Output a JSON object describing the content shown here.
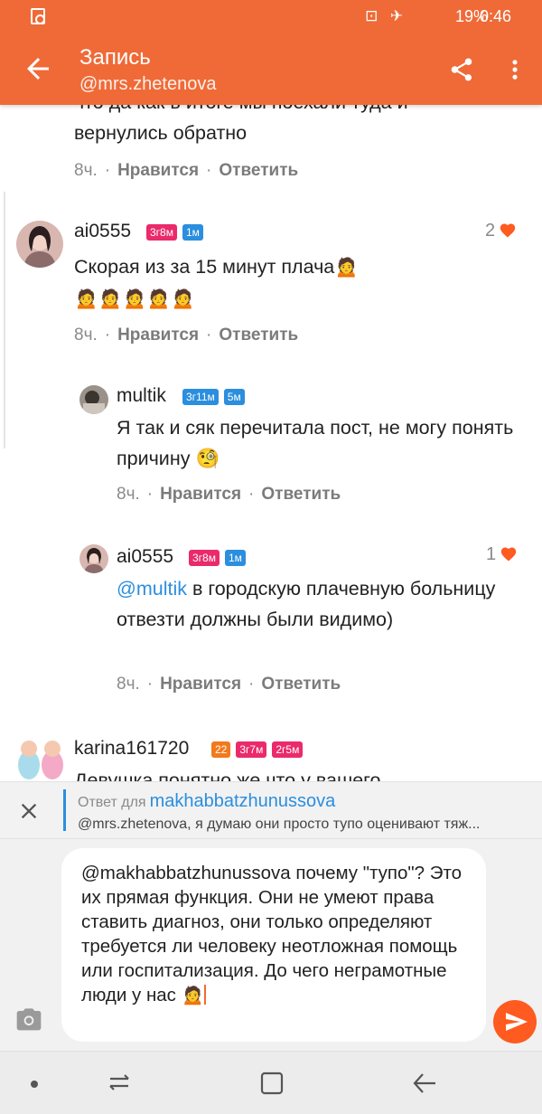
{
  "status_bar": {
    "icons": "⊡ ✈",
    "battery": "19%",
    "time": "0:46"
  },
  "app_bar": {
    "title": "Запись",
    "subtitle": "@mrs.zhetenova"
  },
  "comments": [
    {
      "text": "что да как в итоге мы поехали туда и вернулись обратно",
      "time": "8ч.",
      "like_label": "Нравится",
      "reply_label": "Ответить"
    },
    {
      "username": "ai0555",
      "badges": [
        {
          "label": "3г8м",
          "color": "pink"
        },
        {
          "label": "1м",
          "color": "blue"
        }
      ],
      "text": "Скорая из за 15 минут плача",
      "emoji_line": "🙍🙍🙍🙍🙍",
      "likes": "2",
      "time": "8ч.",
      "like_label": "Нравится",
      "reply_label": "Ответить"
    },
    {
      "username": "multik",
      "badges": [
        {
          "label": "3г11м",
          "color": "blue"
        },
        {
          "label": "5м",
          "color": "blue"
        }
      ],
      "text": "Я так и сяк перечитала пост, не могу понять причину",
      "time": "8ч.",
      "like_label": "Нравится",
      "reply_label": "Ответить"
    },
    {
      "username": "ai0555",
      "badges": [
        {
          "label": "3г8м",
          "color": "pink"
        },
        {
          "label": "1м",
          "color": "blue"
        }
      ],
      "mention": "@multik",
      "text": " в городскую плачевную больницу отвезти должны были видимо)",
      "likes": "1",
      "time": "8ч.",
      "like_label": "Нравится",
      "reply_label": "Ответить"
    },
    {
      "username": "karina161720",
      "badges": [
        {
          "label": "22",
          "color": "orange"
        },
        {
          "label": "3г7м",
          "color": "pink"
        },
        {
          "label": "2г5м",
          "color": "pink"
        }
      ],
      "text": "Девушка понятно же что у вашего"
    }
  ],
  "reply_bar": {
    "label": "Ответ для",
    "user": "makhabbatzhunussova",
    "preview": "@mrs.zhetenova, я думаю они просто тупо оценивают тяж..."
  },
  "composer": {
    "value": "@makhabbatzhunussova почему \"тупо\"? Это их прямая функция. Они не умеют права ставить диагноз, они только определяют требуется ли человеку неотложная помощь или госпитализация. До чего неграмотные люди у нас 🙍"
  },
  "colors": {
    "brand": "#ef6a37",
    "send": "#ff5a1f",
    "badge_pink": "#ea2a6b",
    "badge_blue": "#2b8ede",
    "badge_orange": "#f27a1e",
    "heart": "#ff5a1f"
  },
  "icons": [
    "back-arrow-icon",
    "share-icon",
    "more-vert-icon",
    "heart-icon",
    "close-icon",
    "camera-icon",
    "send-icon",
    "recents-icon",
    "home-icon",
    "back-nav-icon"
  ]
}
